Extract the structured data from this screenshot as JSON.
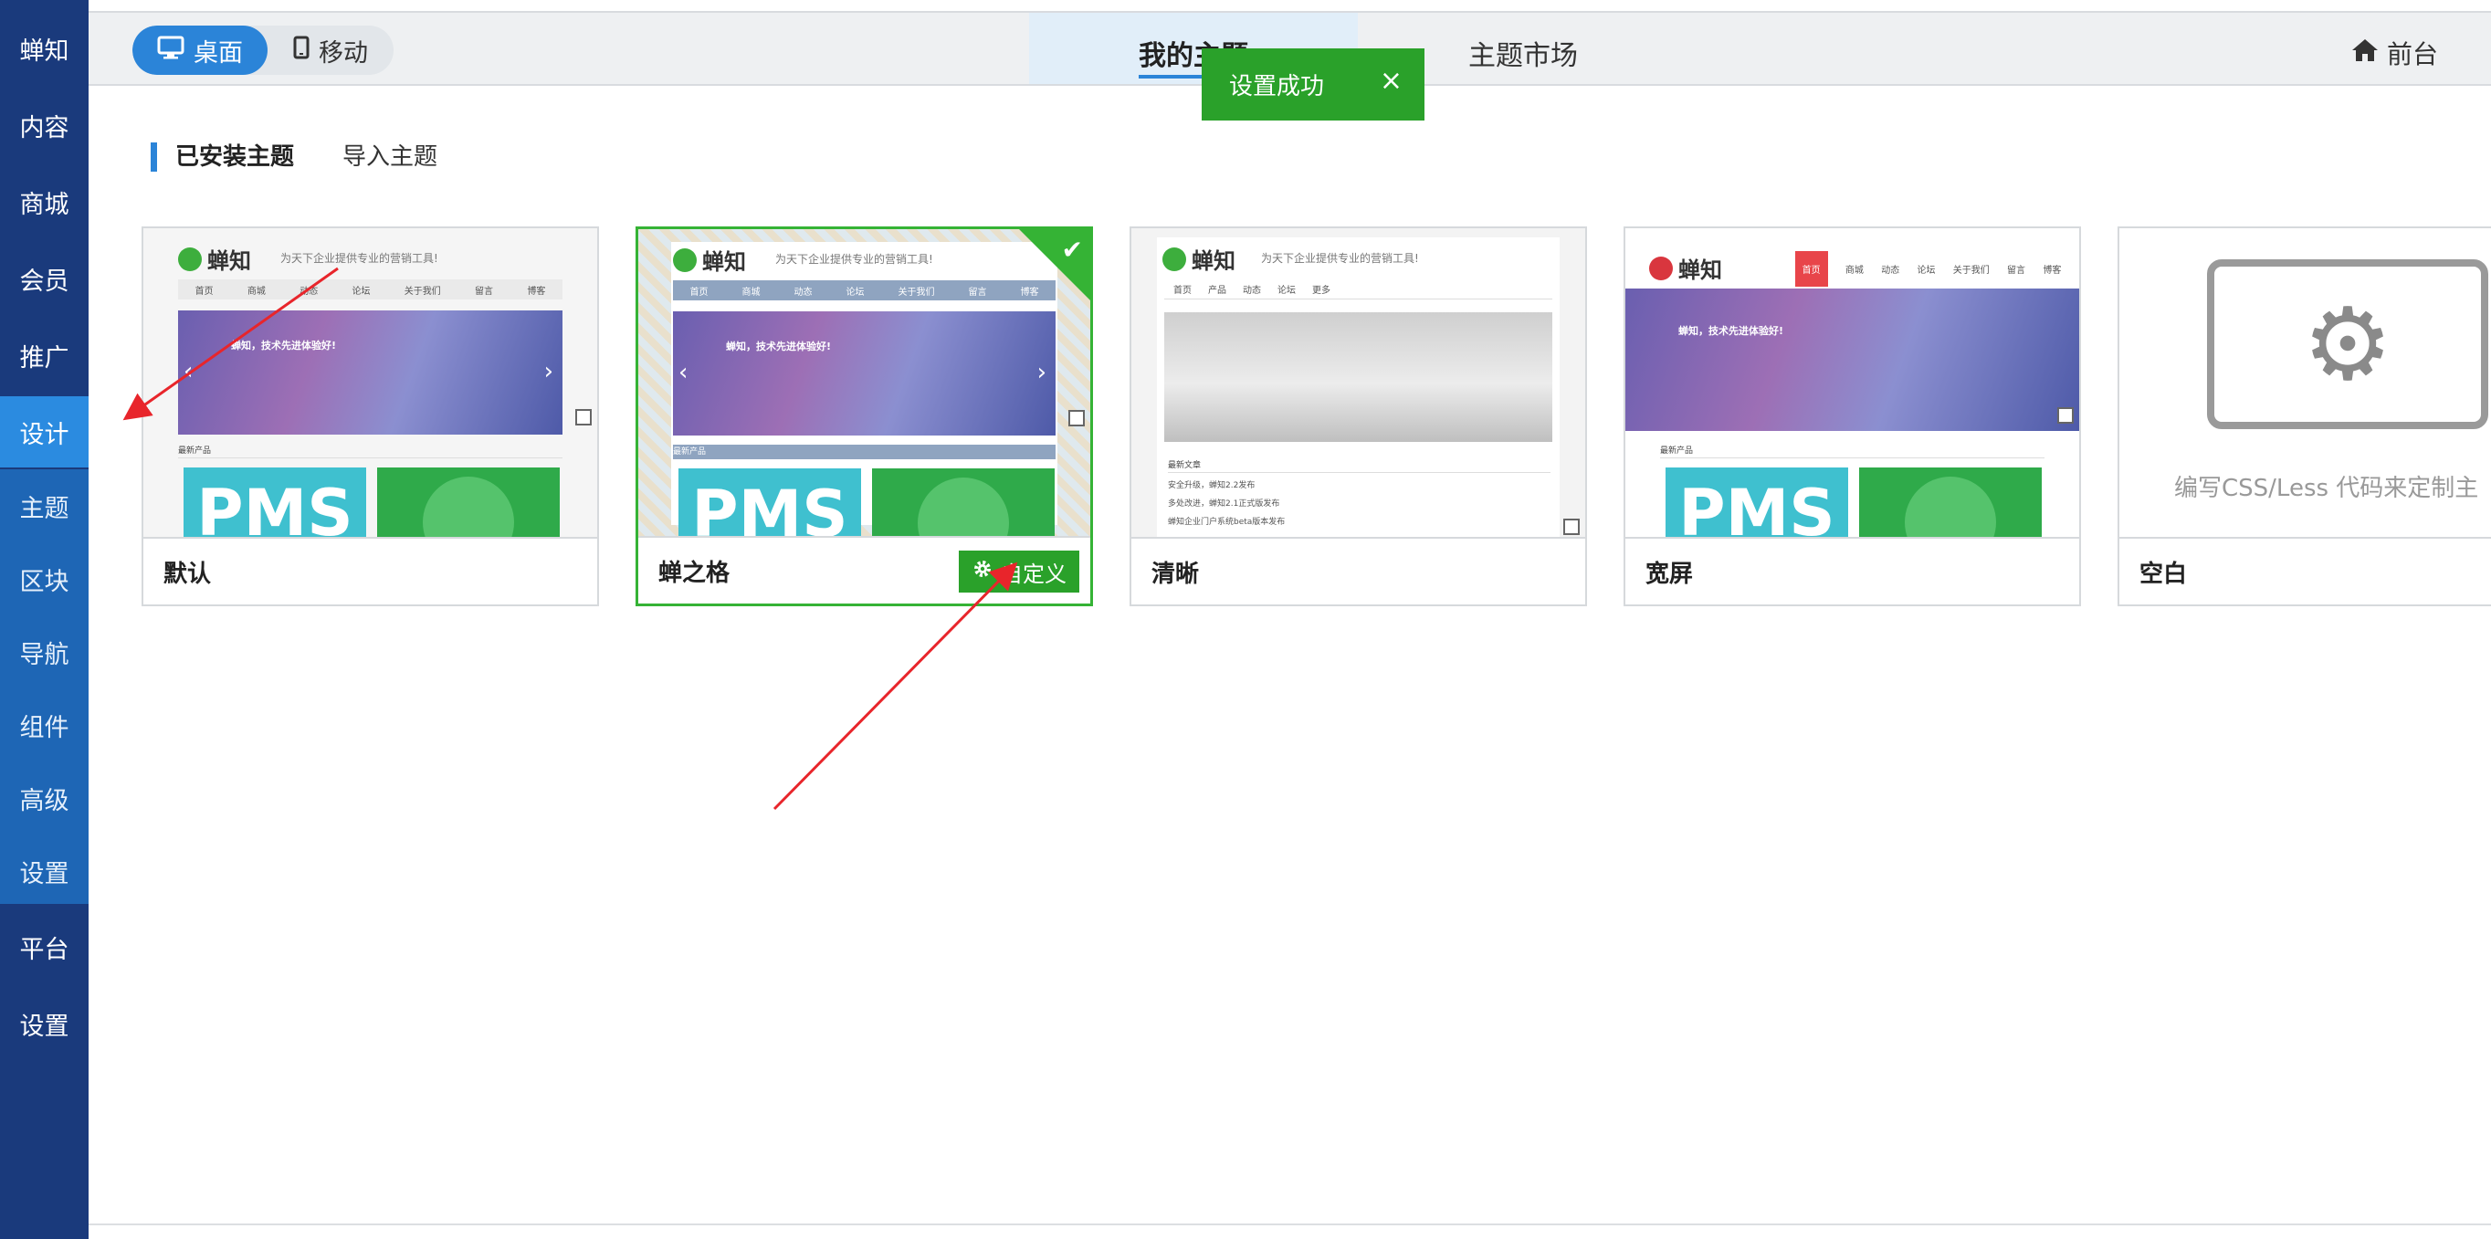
{
  "sidebar": {
    "items": [
      {
        "label": "蝉知"
      },
      {
        "label": "内容"
      },
      {
        "label": "商城"
      },
      {
        "label": "会员"
      },
      {
        "label": "推广"
      },
      {
        "label": "设计"
      },
      {
        "label": "平台"
      },
      {
        "label": "设置"
      }
    ],
    "subitems": [
      {
        "label": "主题"
      },
      {
        "label": "区块"
      },
      {
        "label": "导航"
      },
      {
        "label": "组件"
      },
      {
        "label": "高级"
      },
      {
        "label": "设置"
      }
    ]
  },
  "topbar": {
    "device_toggle": {
      "desktop": "桌面",
      "mobile": "移动"
    },
    "tabs": [
      {
        "label": "我的主题"
      },
      {
        "label": "主题市场"
      }
    ],
    "front_label": "前台"
  },
  "toast": {
    "message": "设置成功",
    "close": "×"
  },
  "section_tabs": {
    "installed": "已安装主题",
    "import": "导入主题"
  },
  "themes": [
    {
      "name": "默认",
      "preview": {
        "brand": "蝉知",
        "slogan": "为天下企业提供专业的营销工具!",
        "nav": [
          "首页",
          "商城",
          "动态",
          "论坛",
          "关于我们",
          "留言",
          "博客"
        ],
        "banner_title": "蝉知，技术先进体验好!",
        "section": "最新产品",
        "product": "PMS"
      }
    },
    {
      "name": "蝉之格",
      "custom_label": "自定义",
      "check": "✔",
      "preview": {
        "brand": "蝉知",
        "slogan": "为天下企业提供专业的营销工具!",
        "nav": [
          "首页",
          "商城",
          "动态",
          "论坛",
          "关于我们",
          "留言",
          "博客"
        ],
        "banner_title": "蝉知，技术先进体验好!",
        "section": "最新产品",
        "product": "PMS"
      }
    },
    {
      "name": "清晰",
      "preview": {
        "brand": "蝉知",
        "slogan": "为天下企业提供专业的营销工具!",
        "nav": [
          "首页",
          "产品",
          "动态",
          "论坛",
          "更多"
        ],
        "section": "最新文章",
        "list": [
          "安全升级，蝉知2.2发布",
          "多处改进，蝉知2.1正式版发布",
          "蝉知企业门户系统beta版本发布"
        ]
      }
    },
    {
      "name": "宽屏",
      "preview": {
        "brand": "蝉知",
        "nav": [
          "首页",
          "商城",
          "动态",
          "论坛",
          "关于我们",
          "留言",
          "博客"
        ],
        "banner_title": "蝉知，技术先进体验好!",
        "section": "最新产品",
        "product": "PMS"
      }
    },
    {
      "name": "空白",
      "preview": {
        "text": "编写CSS/Less 代码来定制主"
      }
    }
  ],
  "colors": {
    "sidebar": "#1a3a7c",
    "subnav": "#1e66b5",
    "active": "#2b8be0",
    "success": "#2aa12a",
    "accent": "#2b84d8"
  }
}
